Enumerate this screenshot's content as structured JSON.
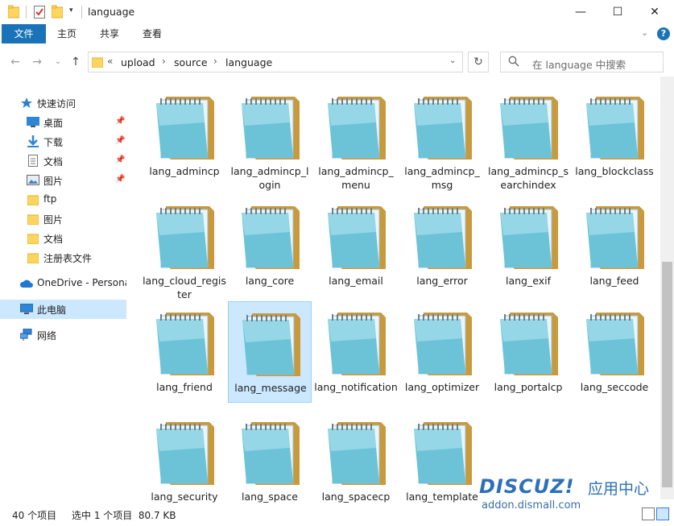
{
  "window": {
    "title": "language",
    "min_glyph": "—",
    "max_glyph": "☐",
    "close_glyph": "✕"
  },
  "ribbon": {
    "tabs": [
      {
        "label": "文件"
      },
      {
        "label": "主页"
      },
      {
        "label": "共享"
      },
      {
        "label": "查看"
      }
    ],
    "help_glyph": "?"
  },
  "address": {
    "prefix": "«",
    "crumbs": [
      "upload",
      "source",
      "language"
    ],
    "search_placeholder": "在 language 中搜索"
  },
  "nav_pane": {
    "quick_access": "快速访问",
    "pinned": [
      {
        "label": "桌面",
        "icon": "desktop-icon"
      },
      {
        "label": "下载",
        "icon": "download-icon"
      },
      {
        "label": "文档",
        "icon": "documents-icon"
      },
      {
        "label": "图片",
        "icon": "pictures-icon"
      }
    ],
    "recent": [
      {
        "label": "ftp"
      },
      {
        "label": "图片"
      },
      {
        "label": "文档"
      },
      {
        "label": "注册表文件"
      }
    ],
    "onedrive": "OneDrive - Persona",
    "this_pc": "此电脑",
    "network": "网络"
  },
  "files": [
    {
      "name": "lang_admincp"
    },
    {
      "name": "lang_admincp_login"
    },
    {
      "name": "lang_admincp_menu"
    },
    {
      "name": "lang_admincp_msg"
    },
    {
      "name": "lang_admincp_searchindex"
    },
    {
      "name": "lang_blockclass"
    },
    {
      "name": "lang_cloud_register"
    },
    {
      "name": "lang_core"
    },
    {
      "name": "lang_email"
    },
    {
      "name": "lang_error"
    },
    {
      "name": "lang_exif"
    },
    {
      "name": "lang_feed"
    },
    {
      "name": "lang_friend"
    },
    {
      "name": "lang_message",
      "selected": true
    },
    {
      "name": "lang_notification"
    },
    {
      "name": "lang_optimizer"
    },
    {
      "name": "lang_portalcp"
    },
    {
      "name": "lang_seccode"
    },
    {
      "name": "lang_security"
    },
    {
      "name": "lang_space"
    },
    {
      "name": "lang_spacecp"
    },
    {
      "name": "lang_template"
    }
  ],
  "status": {
    "count": "40 个项目",
    "selection": "选中 1 个项目  80.7 KB"
  },
  "watermark": {
    "logo": "DISCUZ!",
    "cn": "应用中心",
    "url": "addon.dismall.com"
  },
  "colors": {
    "accent": "#1a73b8",
    "selection": "#cce8ff",
    "folder": "#ffd55e"
  }
}
